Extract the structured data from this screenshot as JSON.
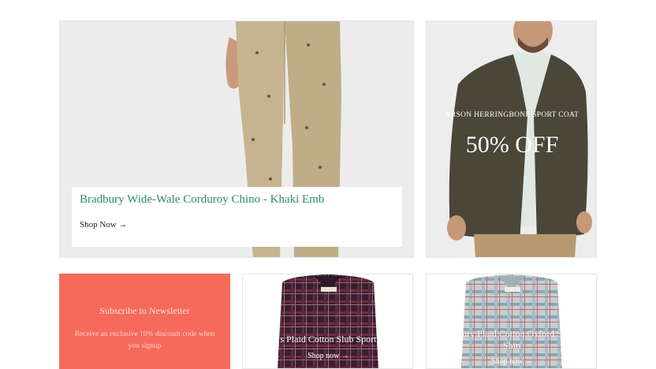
{
  "hero": {
    "title": "Bradbury Wide-Wale Corduroy Chino - Khaki Emb",
    "shop_label": "Shop Now",
    "arrow": "→"
  },
  "coat": {
    "label": "ARSON HERRINGBONE SPORT COAT",
    "discount": "50% OFF"
  },
  "newsletter": {
    "title": "Subscribe to Newsletter",
    "text": "Receive an exclusive 10% discount code when you signup"
  },
  "shirt1": {
    "title": "s Plaid Cotton Slub Sport",
    "shop_label": "Shop now",
    "arrow": "→"
  },
  "shirt2": {
    "title_line1": "ury Plaid Cotton Oxford S",
    "title_line2": "Shirt",
    "shop_label": "Shop now",
    "arrow": "→"
  },
  "colors": {
    "accent_green": "#2e8a6c",
    "newsletter_bg": "#f56a5a"
  }
}
